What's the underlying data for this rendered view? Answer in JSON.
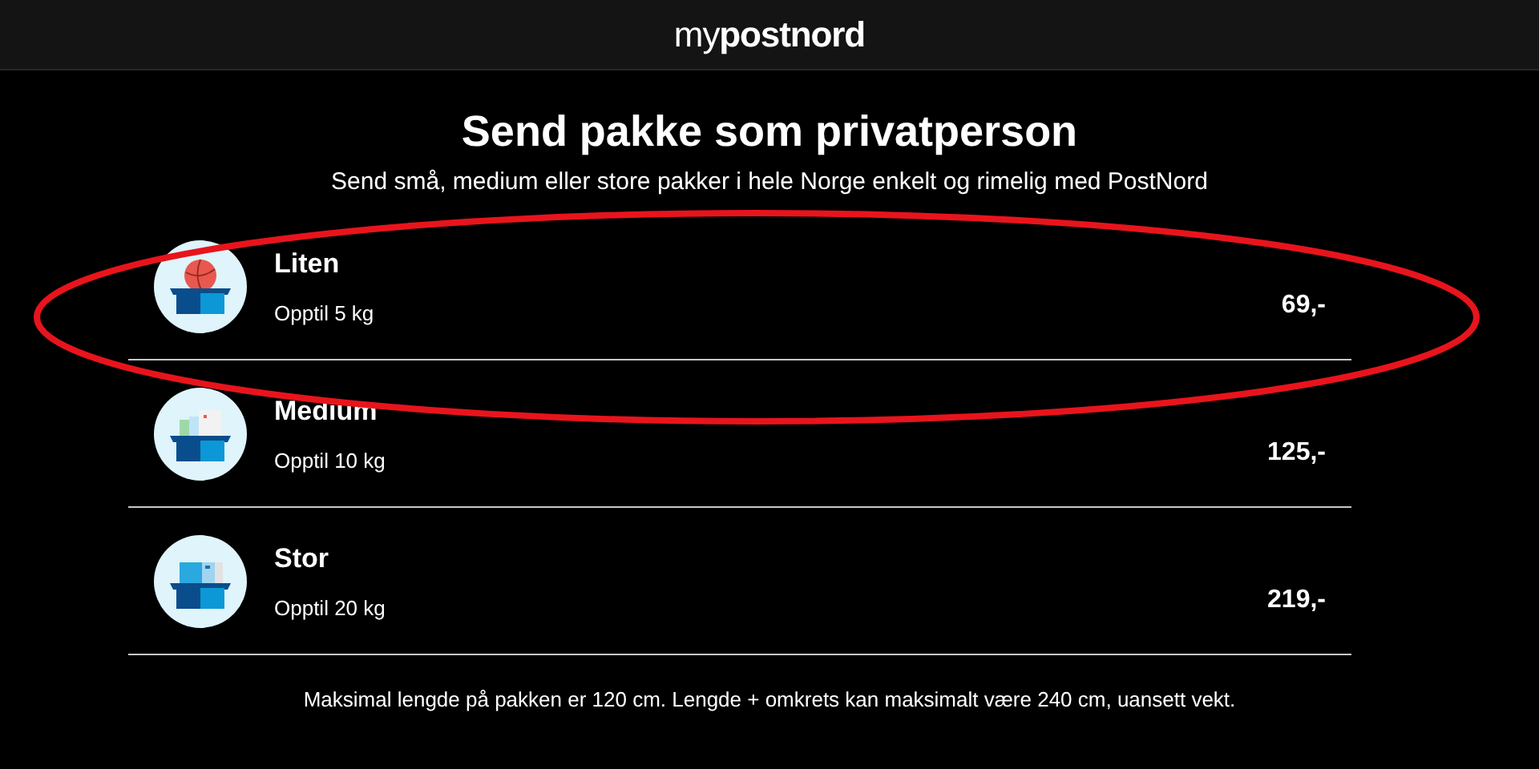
{
  "header": {
    "logo": "my**postnord**"
  },
  "title": "Send pakke som privatperson",
  "subtitle": "Send små, medium eller store pakker i hele Norge enkelt og rimelig med PostNord",
  "packages": [
    {
      "kind": "ball",
      "name": "Liten",
      "weight": "Opptil 5 kg",
      "price": "69,-"
    },
    {
      "kind": "books",
      "name": "Medium",
      "weight": "Opptil 10 kg",
      "price": "125,-"
    },
    {
      "kind": "boxes",
      "name": "Stor",
      "weight": "Opptil 20 kg",
      "price": "219,-"
    }
  ],
  "note": "Maksimal lengde på pakken er 120 cm. Lengde + omkrets kan maksimalt være 240 cm, uansett vekt.",
  "annotation": {
    "kind": "ellipse",
    "color": "#e8141c"
  }
}
